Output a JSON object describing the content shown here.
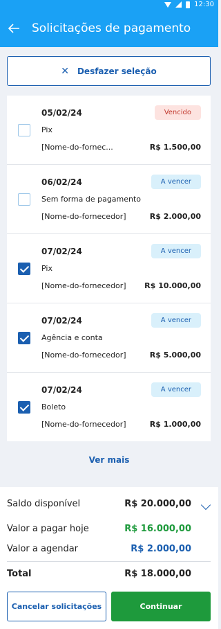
{
  "status_bar": {
    "time": "12:30"
  },
  "header": {
    "title": "Solicitações de pagamento",
    "back_icon": "arrow-left-icon"
  },
  "undo_selection": {
    "label": "Desfazer seleção",
    "icon": "close-icon"
  },
  "requests": [
    {
      "date": "05/02/24",
      "status": "Vencido",
      "status_type": "overdue",
      "checked": false,
      "method": "Pix",
      "supplier": "[Nome-do-fornec...",
      "amount": "R$ 1.500,00"
    },
    {
      "date": "06/02/24",
      "status": "A vencer",
      "status_type": "due",
      "checked": false,
      "method": "Sem forma de pagamento",
      "supplier": "[Nome-do-fornecedor]",
      "amount": "R$ 2.000,00"
    },
    {
      "date": "07/02/24",
      "status": "A vencer",
      "status_type": "due",
      "checked": true,
      "method": "Pix",
      "supplier": "[Nome-do-fornecedor]",
      "amount": "R$ 10.000,00"
    },
    {
      "date": "07/02/24",
      "status": "A vencer",
      "status_type": "due",
      "checked": true,
      "method": "Agência e conta",
      "supplier": "[Nome-do-fornecedor]",
      "amount": "R$ 5.000,00"
    },
    {
      "date": "07/02/24",
      "status": "A vencer",
      "status_type": "due",
      "checked": true,
      "method": "Boleto",
      "supplier": "[Nome-do-fornecedor]",
      "amount": "R$ 1.000,00"
    }
  ],
  "see_more": "Ver mais",
  "summary": {
    "balance_label": "Saldo disponível",
    "balance_value": "R$ 20.000,00",
    "pay_today_label": "Valor a pagar hoje",
    "pay_today_value": "R$ 16.000,00",
    "schedule_label": "Valor a agendar",
    "schedule_value": "R$ 2.000,00",
    "total_label": "Total",
    "total_value": "R$ 18.000,00"
  },
  "actions": {
    "cancel": "Cancelar solicitações",
    "continue": "Continuar"
  },
  "colors": {
    "primary": "#1b5fb0",
    "appbar": "#1aa1f5",
    "success": "#1e9a3c",
    "overdue": "#c23a2f"
  }
}
